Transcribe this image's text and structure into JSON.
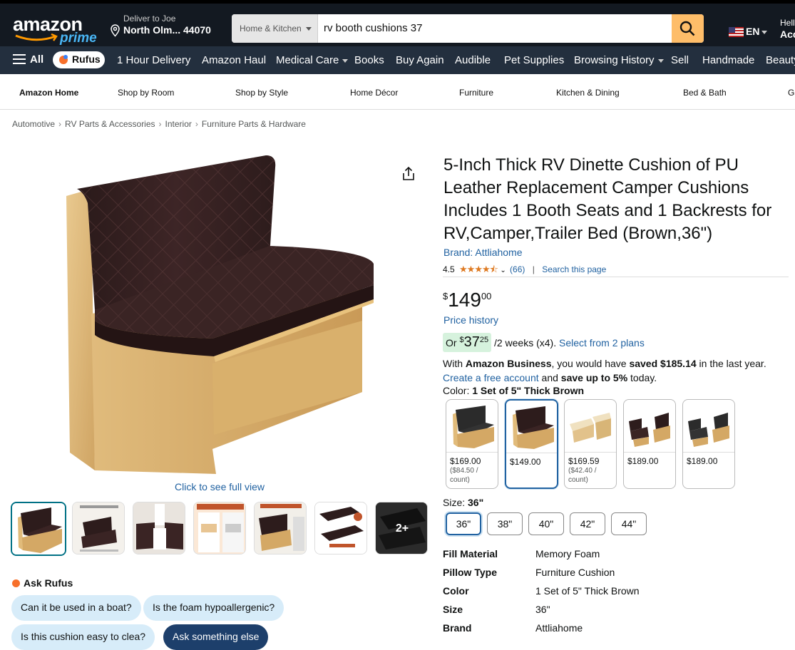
{
  "header": {
    "logo_text": "amazon",
    "logo_sub": "prime",
    "deliver_line1": "Deliver to Joe",
    "deliver_line2": "North Olm... 44070",
    "search_category": "Home & Kitchen",
    "search_query": "rv booth cushions 37",
    "language": "EN",
    "account_line1": "Hell",
    "account_line2": "Acc"
  },
  "nav": {
    "all_label": "All",
    "rufus_label": "Rufus",
    "items": [
      "1 Hour Delivery",
      "Amazon Haul",
      "Medical Care",
      "Books",
      "Buy Again",
      "Audible",
      "Pet Supplies",
      "Browsing History",
      "Sell",
      "Handmade",
      "Beauty"
    ]
  },
  "subnav": {
    "items": [
      "Amazon Home",
      "Shop by Room",
      "Shop by Style",
      "Home Décor",
      "Furniture",
      "Kitchen & Dining",
      "Bed & Bath",
      "Ga"
    ]
  },
  "breadcrumb": [
    "Automotive",
    "RV Parts & Accessories",
    "Interior",
    "Furniture Parts & Hardware"
  ],
  "gallery": {
    "full_view": "Click to see full view",
    "more_label": "2+"
  },
  "product": {
    "title": "5-Inch Thick RV Dinette Cushion of PU Leather Replacement Camper Cushions Includes 1 Booth Seats and 1 Backrests for RV,Camper,Trailer Bed (Brown,36\")",
    "brand": "Brand: Attliahome",
    "rating_value": "4.5",
    "rating_stars": "★★★★⯪",
    "rating_count": "(66)",
    "search_page": "Search this page",
    "price_symbol": "$",
    "price_whole": "149",
    "price_fraction": "00",
    "price_history": "Price history",
    "installment_prefix": "Or",
    "installment_symbol": "$",
    "installment_whole": "37",
    "installment_fraction": "25",
    "installment_term": "/2 weeks (x4).",
    "installment_link": "Select from 2 plans",
    "business_1a": "With ",
    "business_1b": "Amazon Business",
    "business_1c": ", you would have ",
    "business_1d": "saved $185.14",
    "business_1e": " in the last year.",
    "business_2a": "Create a free account",
    "business_2b": " and ",
    "business_2c": "save up to 5%",
    "business_2d": " today.",
    "color_label": "Color:",
    "color_value": "1 Set of 5\" Thick Brown",
    "swatches": [
      {
        "price": "$169.00",
        "unit": "($84.50 / count)"
      },
      {
        "price": "$149.00",
        "unit": ""
      },
      {
        "price": "$169.59",
        "unit": "($42.40 / count)"
      },
      {
        "price": "$189.00",
        "unit": ""
      },
      {
        "price": "$189.00",
        "unit": ""
      }
    ],
    "size_label": "Size:",
    "size_value": "36\"",
    "sizes": [
      "36\"",
      "38\"",
      "40\"",
      "42\"",
      "44\""
    ],
    "specs": [
      {
        "k": "Fill Material",
        "v": "Memory Foam"
      },
      {
        "k": "Pillow Type",
        "v": "Furniture Cushion"
      },
      {
        "k": "Color",
        "v": "1 Set of 5\" Thick Brown"
      },
      {
        "k": "Size",
        "v": "36\""
      },
      {
        "k": "Brand",
        "v": "Attliahome"
      }
    ]
  },
  "rufus": {
    "heading": "Ask Rufus",
    "questions": [
      "Can it be used in a boat?",
      "Is the foam hypoallergenic?",
      "Is this cushion easy to clea?",
      "Ask something else"
    ]
  },
  "colors": {
    "header_bg": "#131921",
    "nav_bg": "#232f3e",
    "search_button": "#febd69",
    "link": "#2162a1",
    "star": "#de7921",
    "installment_bg": "#d6f2dd"
  }
}
